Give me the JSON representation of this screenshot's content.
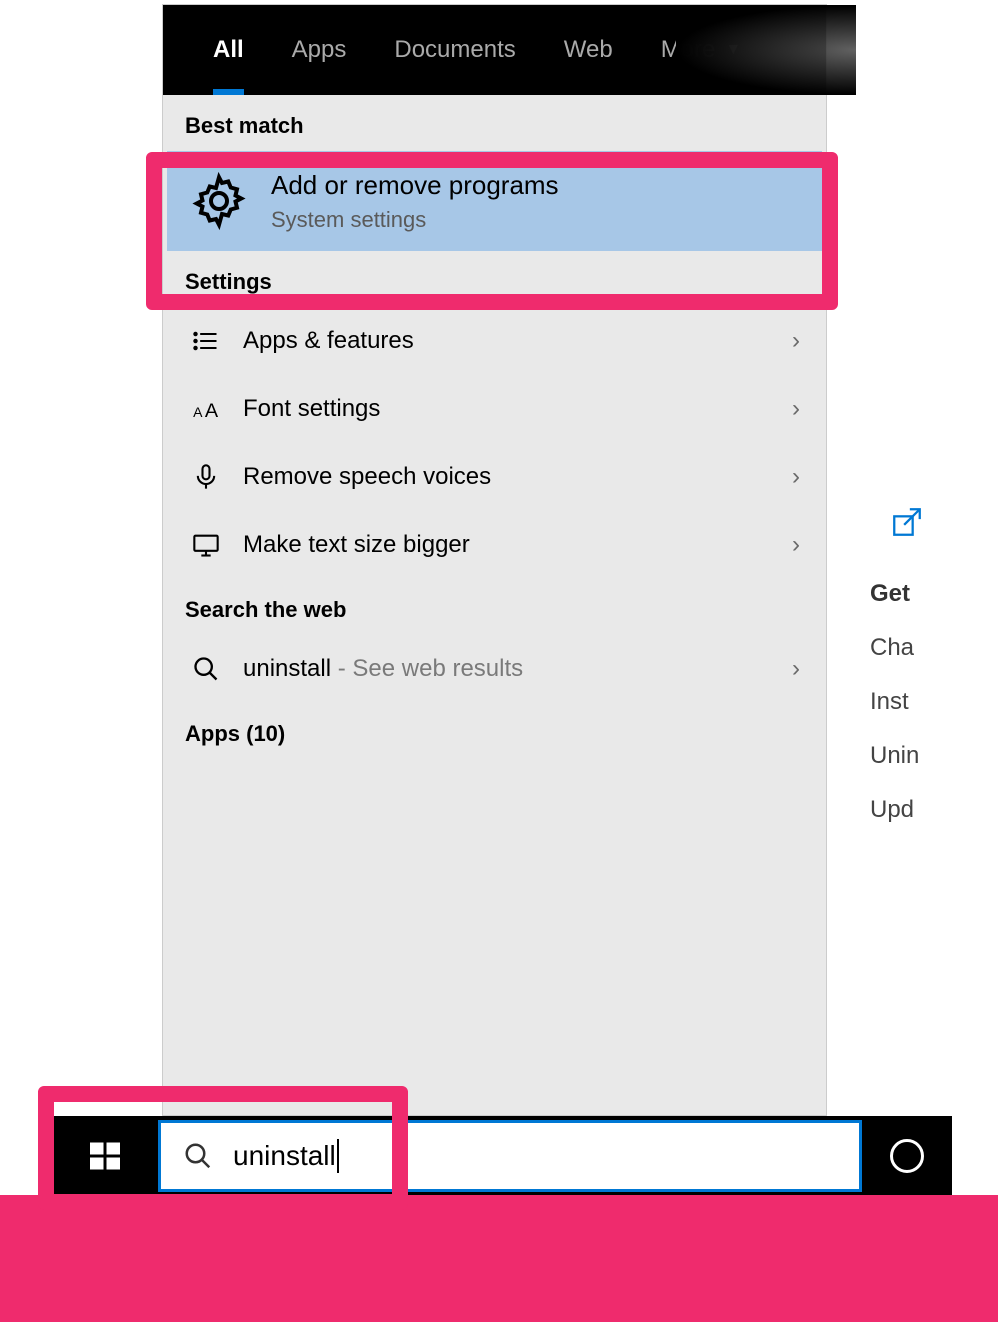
{
  "tabs": {
    "all": "All",
    "apps": "Apps",
    "documents": "Documents",
    "web": "Web",
    "more": "More"
  },
  "sections": {
    "best_match": "Best match",
    "settings": "Settings",
    "search_web": "Search the web",
    "apps_count": "Apps (10)"
  },
  "best_match": {
    "title": "Add or remove programs",
    "subtitle": "System settings"
  },
  "settings_items": [
    {
      "label": "Apps & features"
    },
    {
      "label": "Font settings"
    },
    {
      "label": "Remove speech voices"
    },
    {
      "label": "Make text size bigger"
    }
  ],
  "web_search": {
    "term": "uninstall",
    "suffix": " - See web results"
  },
  "search_box": {
    "value": "uninstall"
  },
  "right_panel": {
    "get": "Get",
    "change": "Cha",
    "install": "Inst",
    "uninstall": "Unin",
    "update": "Upd"
  }
}
